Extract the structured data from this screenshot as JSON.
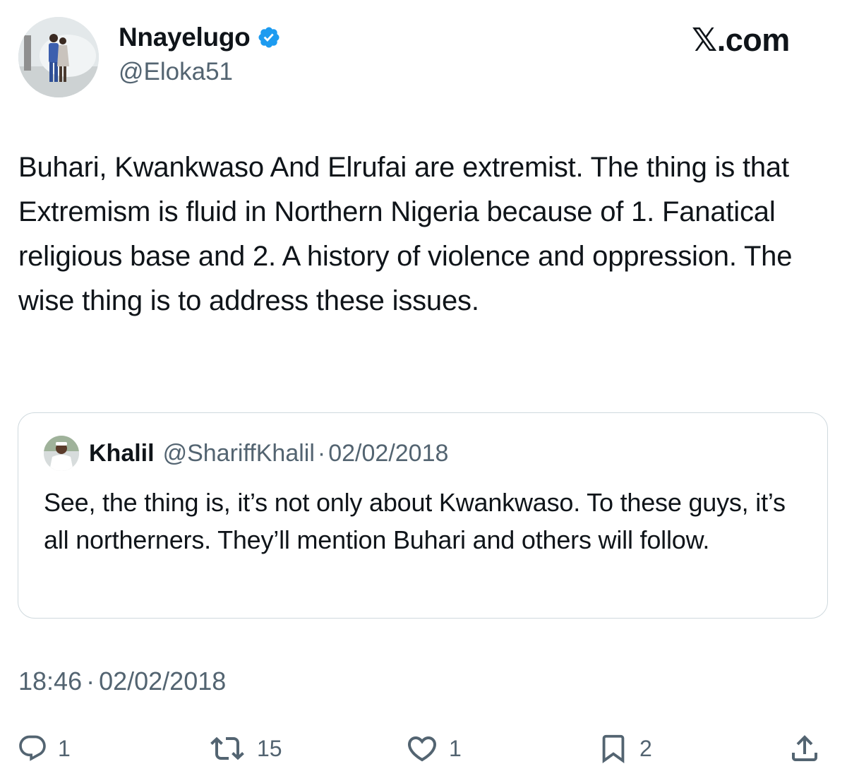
{
  "author": {
    "name": "Nnayelugo",
    "handle": "@Eloka51",
    "verified": true,
    "verified_color": "#1d9bf0"
  },
  "brand": {
    "logo_text": ".com",
    "logo_glyph": "𝕏"
  },
  "tweet": {
    "text": "Buhari, Kwankwaso And Elrufai are extremist. The thing is that Extremism is fluid in Northern Nigeria because of 1. Fanatical religious base and 2. A history of violence and oppression. The wise thing is to address these issues.",
    "time": "18:46",
    "separator": "·",
    "date": "02/02/2018"
  },
  "quoted_tweet": {
    "name": "Khalil",
    "handle": "@ShariffKhalil",
    "separator": "·",
    "date": "02/02/2018",
    "text": "See, the thing is, it’s not only about Kwankwaso. To these guys, it’s all northerners. They’ll mention Buhari and others will follow."
  },
  "actions": {
    "reply": {
      "icon": "reply-icon",
      "count": "1"
    },
    "retweet": {
      "icon": "retweet-icon",
      "count": "15"
    },
    "like": {
      "icon": "heart-icon",
      "count": "1"
    },
    "bookmark": {
      "icon": "bookmark-icon",
      "count": "2"
    },
    "share": {
      "icon": "share-icon"
    }
  },
  "colors": {
    "text_primary": "#0f1419",
    "text_secondary": "#536471",
    "border": "#cfd9de",
    "background": "#ffffff"
  }
}
